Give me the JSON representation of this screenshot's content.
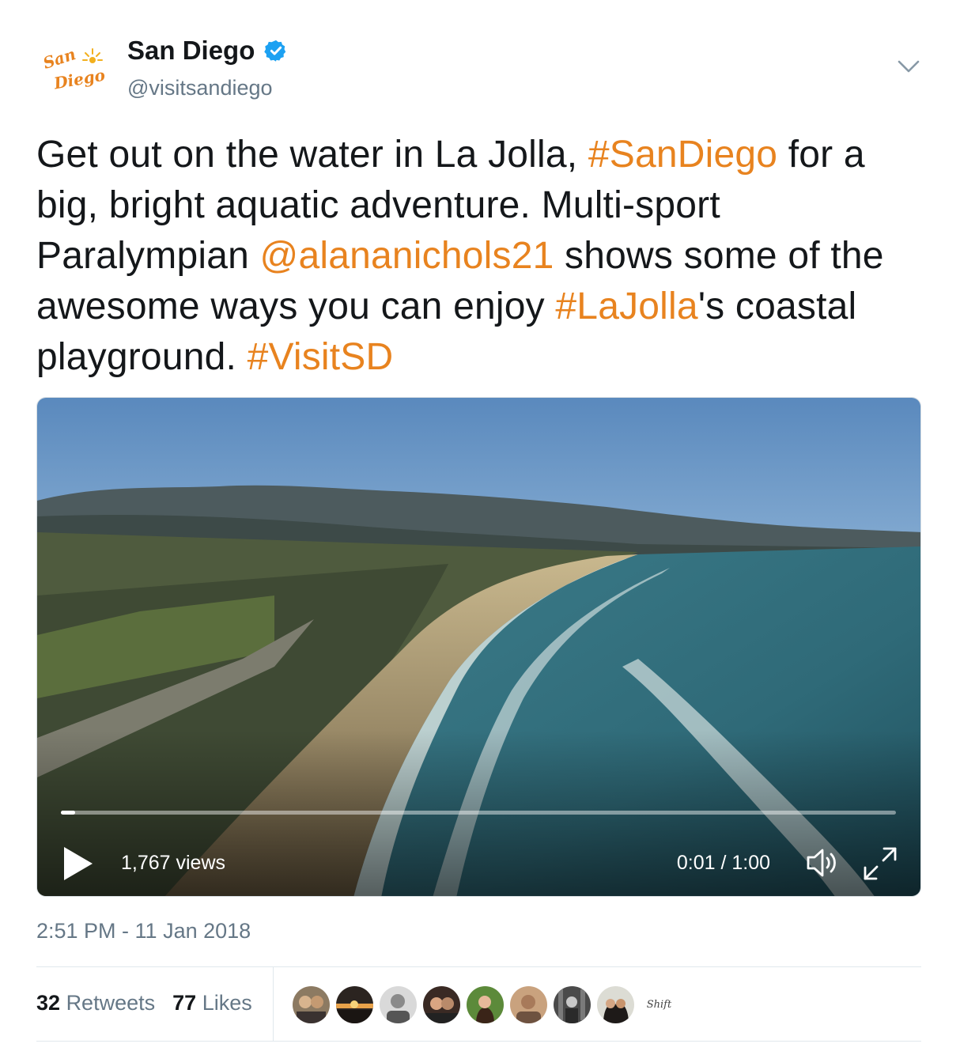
{
  "tweet": {
    "display_name": "San Diego",
    "handle": "@visitsandiego",
    "logo_text": {
      "line1": "San",
      "line2": "Diego"
    },
    "text_segments": [
      {
        "text": "Get out on the water in La Jolla, ",
        "link": false
      },
      {
        "text": "#SanDiego",
        "link": true
      },
      {
        "text": " for a big, bright aquatic adventure. Multi-sport Paralympian ",
        "link": false
      },
      {
        "text": "@alananichols21",
        "link": true
      },
      {
        "text": " shows some of the awesome ways you can enjoy ",
        "link": false
      },
      {
        "text": "#LaJolla",
        "link": true
      },
      {
        "text": "'s coastal playground. ",
        "link": false
      },
      {
        "text": "#VisitSD",
        "link": true
      }
    ],
    "timestamp": "2:51 PM - 11 Jan 2018"
  },
  "video": {
    "views": "1,767 views",
    "time": "0:01 / 1:00",
    "progress_fraction": 0.016
  },
  "stats": {
    "retweets_count": "32",
    "retweets_label": "Retweets",
    "likes_count": "77",
    "likes_label": "Likes"
  },
  "liker_avatars": [
    "avatar-1",
    "avatar-2",
    "avatar-3",
    "avatar-4",
    "avatar-5",
    "avatar-6",
    "avatar-7",
    "avatar-8",
    "avatar-9"
  ],
  "last_avatar_text": "Shift",
  "colors": {
    "link": "#e8831f",
    "secondary_text": "#657786",
    "verified": "#1da1f2"
  },
  "icons": {
    "caret": "chevron-down-icon",
    "verified": "verified-badge-icon",
    "play": "play-icon",
    "volume": "volume-icon",
    "fullscreen": "fullscreen-icon"
  }
}
